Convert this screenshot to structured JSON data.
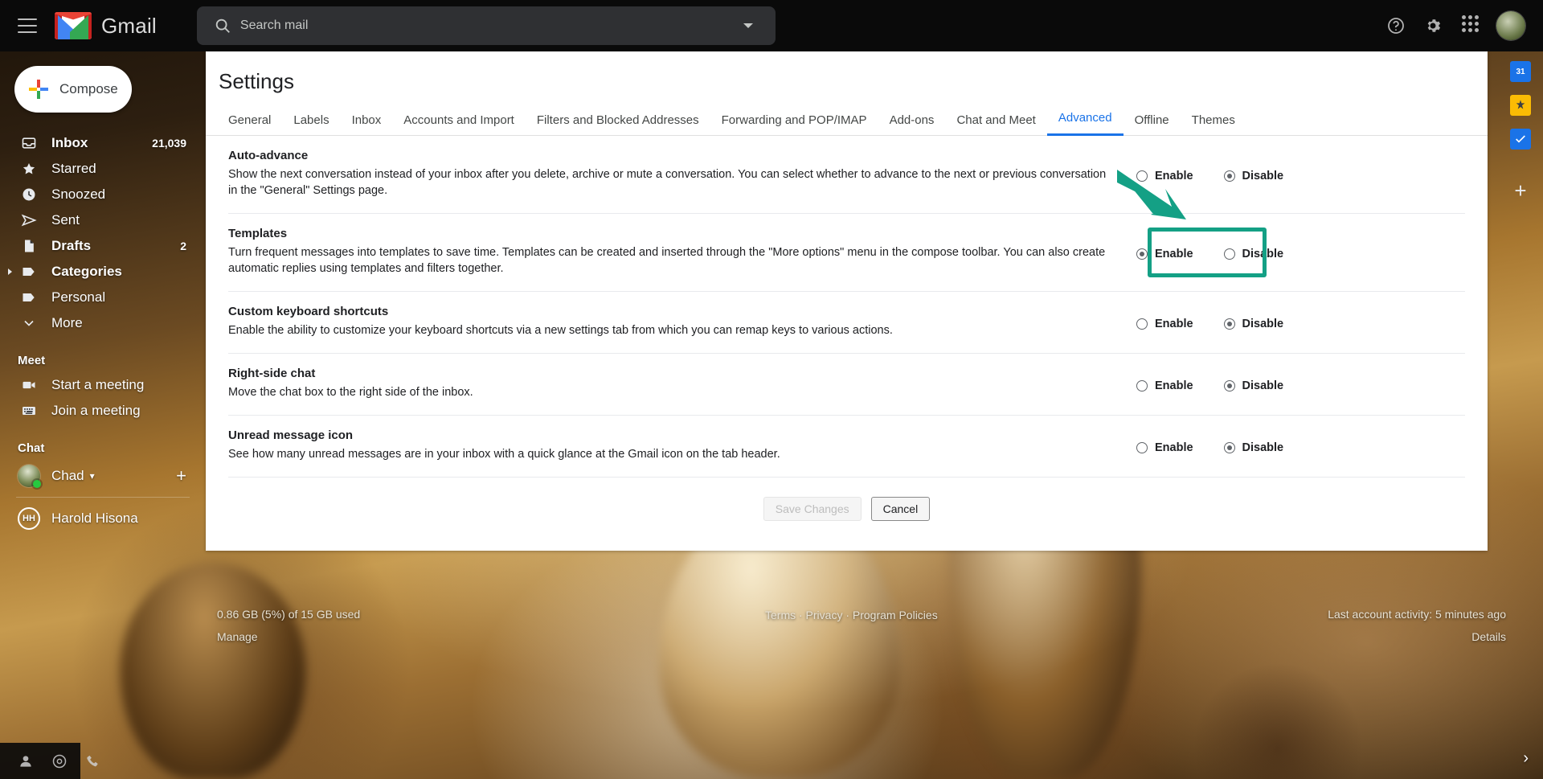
{
  "topbar": {
    "menu_icon": "hamburger-icon",
    "brand": "Gmail",
    "search_placeholder": "Search mail",
    "search_value": "",
    "search_icon": "search-icon",
    "filter_icon": "chevron-down-icon",
    "help_icon": "help-icon",
    "settings_icon": "gear-icon",
    "apps_icon": "apps-grid-icon",
    "avatar": "account-avatar"
  },
  "sidebar": {
    "compose_label": "Compose",
    "nav": [
      {
        "label": "Inbox",
        "count": "21,039",
        "icon": "inbox-icon",
        "bold": true
      },
      {
        "label": "Starred",
        "count": "",
        "icon": "star-icon",
        "bold": false
      },
      {
        "label": "Snoozed",
        "count": "",
        "icon": "clock-icon",
        "bold": false
      },
      {
        "label": "Sent",
        "count": "",
        "icon": "send-icon",
        "bold": false
      },
      {
        "label": "Drafts",
        "count": "2",
        "icon": "draft-icon",
        "bold": true
      },
      {
        "label": "Categories",
        "count": "",
        "icon": "label-icon",
        "bold": true
      },
      {
        "label": "Personal",
        "count": "",
        "icon": "label-icon",
        "bold": false
      },
      {
        "label": "More",
        "count": "",
        "icon": "chevron-down-icon",
        "bold": false
      }
    ],
    "meet": {
      "title": "Meet",
      "items": [
        {
          "label": "Start a meeting",
          "icon": "video-camera-icon"
        },
        {
          "label": "Join a meeting",
          "icon": "keyboard-icon"
        }
      ]
    },
    "chat": {
      "title": "Chat",
      "me": {
        "name": "Chad",
        "status_icon": "status-online-dot",
        "caret": "▾"
      },
      "add_icon": "plus-icon",
      "contacts": [
        {
          "name": "Harold Hisona",
          "initials": "HH"
        }
      ]
    }
  },
  "settings": {
    "title": "Settings",
    "tabs": [
      {
        "label": "General",
        "active": false
      },
      {
        "label": "Labels",
        "active": false
      },
      {
        "label": "Inbox",
        "active": false
      },
      {
        "label": "Accounts and Import",
        "active": false
      },
      {
        "label": "Filters and Blocked Addresses",
        "active": false
      },
      {
        "label": "Forwarding and POP/IMAP",
        "active": false
      },
      {
        "label": "Add-ons",
        "active": false
      },
      {
        "label": "Chat and Meet",
        "active": false
      },
      {
        "label": "Advanced",
        "active": true
      },
      {
        "label": "Offline",
        "active": false
      },
      {
        "label": "Themes",
        "active": false
      }
    ],
    "rows": [
      {
        "name": "Auto-advance",
        "description": "Show the next conversation instead of your inbox after you delete, archive or mute a conversation. You can select whether to advance to the next or previous conversation in the \"General\" Settings page.",
        "options": [
          {
            "label": "Enable",
            "selected": false
          },
          {
            "label": "Disable",
            "selected": true
          }
        ],
        "highlighted": false
      },
      {
        "name": "Templates",
        "description": "Turn frequent messages into templates to save time. Templates can be created and inserted through the \"More options\" menu in the compose toolbar. You can also create automatic replies using templates and filters together.",
        "options": [
          {
            "label": "Enable",
            "selected": true
          },
          {
            "label": "Disable",
            "selected": false
          }
        ],
        "highlighted": true
      },
      {
        "name": "Custom keyboard shortcuts",
        "description": "Enable the ability to customize your keyboard shortcuts via a new settings tab from which you can remap keys to various actions.",
        "options": [
          {
            "label": "Enable",
            "selected": false
          },
          {
            "label": "Disable",
            "selected": true
          }
        ],
        "highlighted": false
      },
      {
        "name": "Right-side chat",
        "description": "Move the chat box to the right side of the inbox.",
        "options": [
          {
            "label": "Enable",
            "selected": false
          },
          {
            "label": "Disable",
            "selected": true
          }
        ],
        "highlighted": false
      },
      {
        "name": "Unread message icon",
        "description": "See how many unread messages are in your inbox with a quick glance at the Gmail icon on the tab header.",
        "options": [
          {
            "label": "Enable",
            "selected": false
          },
          {
            "label": "Disable",
            "selected": true
          }
        ],
        "highlighted": false
      }
    ],
    "save_label": "Save Changes",
    "save_disabled": true,
    "cancel_label": "Cancel"
  },
  "annotation": {
    "color": "#14a085",
    "arrow_icon": "arrow-pointer-icon",
    "target": "Templates Enable radio"
  },
  "footer": {
    "storage": "0.86 GB (5%) of 15 GB used",
    "manage": "Manage",
    "links": "Terms · Privacy · Program Policies",
    "activity": "Last account activity: 5 minutes ago",
    "details": "Details"
  },
  "rail": {
    "items": [
      {
        "icon": "calendar-icon",
        "label": "31"
      },
      {
        "icon": "keep-icon",
        "label": ""
      },
      {
        "icon": "tasks-icon",
        "label": ""
      },
      {
        "icon": "add-icon",
        "label": "+"
      }
    ]
  },
  "bottombar": {
    "items": [
      {
        "icon": "contacts-icon"
      },
      {
        "icon": "meet-icon"
      },
      {
        "icon": "phone-icon"
      }
    ],
    "expand_icon": "chevron-right-icon"
  }
}
